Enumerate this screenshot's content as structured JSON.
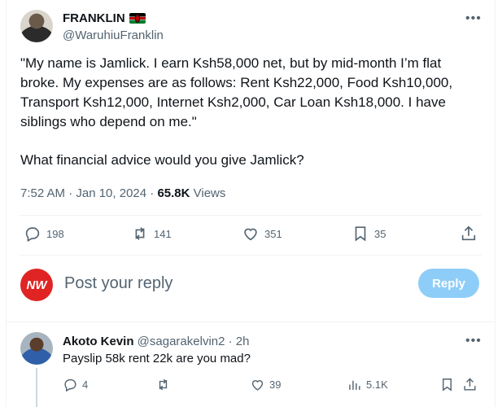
{
  "tweet": {
    "display_name": "FRANKLIN",
    "flag_icon": "kenya-flag-icon",
    "handle": "@WaruhiuFranklin",
    "body": "\"My name is Jamlick. I earn Ksh58,000 net, but by mid-month I’m flat broke. My expenses are as follows: Rent Ksh22,000, Food Ksh10,000, Transport Ksh12,000, Internet Ksh2,000, Car Loan Ksh18,000. I have siblings who depend on me.\"",
    "question": "What financial advice would you give Jamlick?",
    "time": "7:52 AM · Jan 10, 2024 · ",
    "views_count": "65.8K",
    "views_label": " Views",
    "actions": {
      "replies": "198",
      "reposts": "141",
      "likes": "351",
      "bookmarks": "35"
    }
  },
  "reply_composer": {
    "avatar_text": "NW",
    "placeholder": "Post your reply",
    "button_label": "Reply"
  },
  "reply": {
    "display_name": "Akoto Kevin",
    "handle_time": " @sagarakelvin2 · 2h",
    "text": "Payslip 58k rent 22k are you mad?",
    "actions": {
      "replies": "4",
      "reposts": "",
      "likes": "39",
      "views": "5.1K"
    }
  },
  "colors": {
    "reply_button": "#8ecdf8",
    "nw_avatar": "#e02424",
    "secondary_text": "#536471"
  }
}
